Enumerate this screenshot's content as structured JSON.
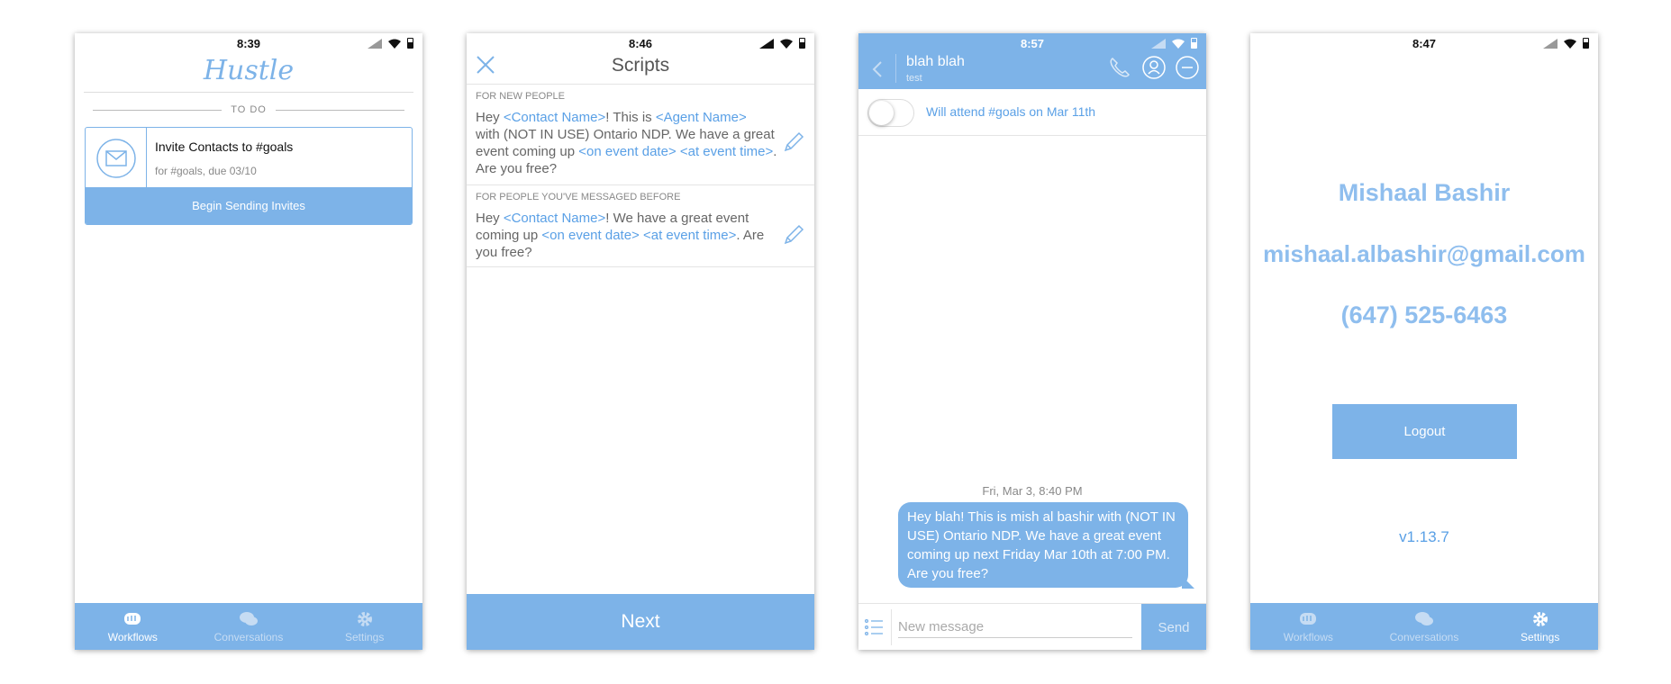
{
  "colors": {
    "accent": "#7db3e8",
    "link": "#5aa0e6",
    "tab_inactive": "#c6dcf3"
  },
  "tabs": [
    {
      "label": "Workflows",
      "icon": "fist-icon"
    },
    {
      "label": "Conversations",
      "icon": "chat-bubbles-icon"
    },
    {
      "label": "Settings",
      "icon": "gear-icon"
    }
  ],
  "screen1": {
    "time": "8:39",
    "logo": "Hustle",
    "section_label": "TO DO",
    "task": {
      "icon": "envelope-icon",
      "title": "Invite Contacts to #goals",
      "subtitle": "for #goals, due 03/10",
      "action": "Begin Sending Invites"
    },
    "active_tab": "Workflows"
  },
  "screen2": {
    "time": "8:46",
    "title": "Scripts",
    "sections": [
      {
        "label": "FOR NEW PEOPLE",
        "text": {
          "t1": "Hey ",
          "tok1": "<Contact Name>",
          "t2": "! This is ",
          "tok2": "<Agent Name>",
          "t3": "with (NOT IN USE) Ontario NDP. We have a great event coming up ",
          "tok3": "<on event date>",
          "t4": " ",
          "tok4": "<at event time>",
          "t5": ". Are you free?"
        }
      },
      {
        "label": "FOR PEOPLE YOU'VE MESSAGED BEFORE",
        "text": {
          "t1": "Hey ",
          "tok1": "<Contact Name>",
          "t2": "! We have a great event coming up ",
          "tok2": "<on event date>",
          "t3": " ",
          "tok3": "<at event time>",
          "t4": ". Are you free?"
        }
      }
    ],
    "next_label": "Next"
  },
  "screen3": {
    "time": "8:57",
    "contact_name": "blah blah",
    "contact_sub": "test",
    "rsvp_toggle": {
      "label": "Will attend #goals on Mar 11th",
      "on": false
    },
    "message": {
      "timestamp": "Fri, Mar 3, 8:40 PM",
      "text": "Hey blah! This is mish al bashir with (NOT IN USE) Ontario NDP. We have a great event coming up next Friday Mar 10th at 7:00 PM. Are you free?"
    },
    "compose_placeholder": "New message",
    "send_label": "Send"
  },
  "screen4": {
    "time": "8:47",
    "name": "Mishaal Bashir",
    "email": "mishaal.albashir@gmail.com",
    "phone": "(647) 525-6463",
    "logout_label": "Logout",
    "version": "v1.13.7",
    "active_tab": "Settings"
  }
}
